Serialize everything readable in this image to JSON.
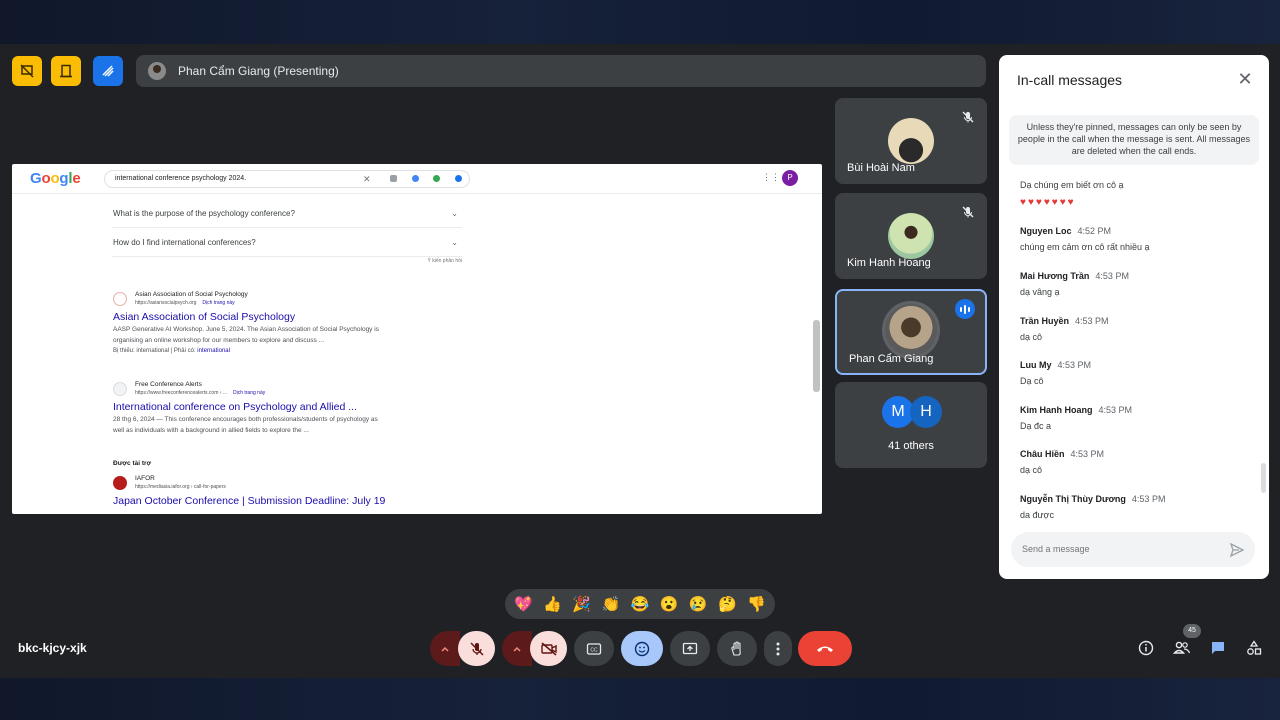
{
  "presenting": {
    "label": "Phan Cẩm Giang (Presenting)"
  },
  "screen": {
    "logo": "Google",
    "query": "international conference psychology 2024.",
    "profile_initial": "P",
    "faqs": [
      "What is the purpose of the psychology conference?",
      "How do I find international conferences?"
    ],
    "feedback": "Ý kiến phản hồi",
    "results": [
      {
        "site": "Asian Association of Social Psychology",
        "url": "https://asiansocialpsych.org",
        "translate": "Dịch trang này",
        "title": "Asian Association of Social Psychology",
        "snippet1": "AASP Generative AI Workshop. June 5, 2024. The Asian Association of Social Psychology is",
        "snippet2": "organising an online workshop for our members to explore and discuss ...",
        "extra_prefix": "Bị thiếu: international | Phải có:",
        "extra_link": "international"
      },
      {
        "site": "Free Conference Alerts",
        "url": "https://www.freeconferencealerts.com › ...",
        "translate": "Dịch trang này",
        "title": "International conference on Psychology and Allied ...",
        "snippet1": "28 thg 6, 2024 — This conference encourages both professionals/students of psychology as",
        "snippet2": "well as individuals with a background in allied fields to explore the ..."
      },
      {
        "site": "IAFOR",
        "url": "https://mediasia.iafor.org › call-for-papers",
        "title": "Japan October Conference | Submission Deadline: July 19"
      }
    ],
    "sponsored": "Được tài trợ"
  },
  "tiles": [
    {
      "name": "Bùi Hoài Nam",
      "muted": true
    },
    {
      "name": "Kim Hanh Hoang",
      "muted": true
    },
    {
      "name": "Phan Cẩm Giang",
      "speaking": true
    },
    {
      "initials": [
        "M",
        "H"
      ],
      "others": "41 others"
    }
  ],
  "chat": {
    "title": "In-call messages",
    "note": "Unless they're pinned, messages can only be seen by people in the call when the message is sent. All messages are deleted when the call ends.",
    "messages": [
      {
        "sender": "",
        "time": "",
        "text": "Dạ chúng em biết ơn cô ạ",
        "hearts": "♥♥♥♥♥♥♥"
      },
      {
        "sender": "Nguyen Loc",
        "time": "4:52 PM",
        "text": "chúng em cảm ơn cô rất nhiều ạ"
      },
      {
        "sender": "Mai Hương Trần",
        "time": "4:53 PM",
        "text": "dạ vâng ạ"
      },
      {
        "sender": "Trần Huyền",
        "time": "4:53 PM",
        "text": "dạ cô"
      },
      {
        "sender": "Luu My",
        "time": "4:53 PM",
        "text": "Dạ cô"
      },
      {
        "sender": "Kim Hanh Hoang",
        "time": "4:53 PM",
        "text": "Dạ đc a"
      },
      {
        "sender": "Châu Hiền",
        "time": "4:53 PM",
        "text": "dạ cô"
      },
      {
        "sender": "Nguyễn Thị Thùy Dương",
        "time": "4:53 PM",
        "text": "da được"
      }
    ],
    "input_placeholder": "Send a message"
  },
  "reactions": [
    "💖",
    "👍",
    "🎉",
    "👏",
    "😂",
    "😮",
    "😢",
    "🤔",
    "👎"
  ],
  "meeting_code": "bkc-kjcy-xjk",
  "participants_count": "45",
  "colors": {
    "bg": "#202124",
    "tile": "#3c4043",
    "yellow_btn": "#fbbc04",
    "blue_btn": "#1a73e8",
    "muted_ctrl": "#f9dedc",
    "end_call": "#ea4335",
    "active_ctrl": "#a8c7fa"
  }
}
